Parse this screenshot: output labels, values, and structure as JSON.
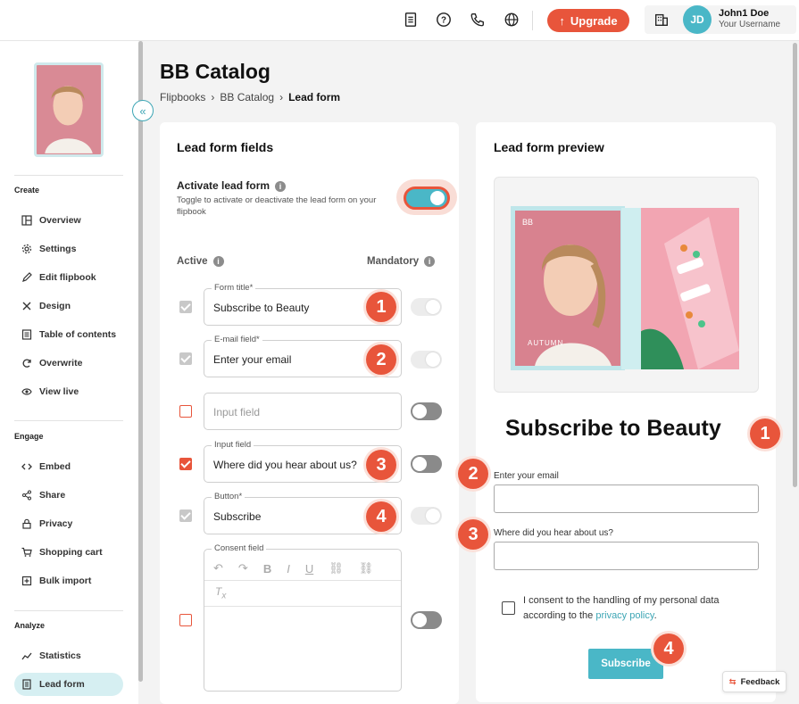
{
  "topbar": {
    "upgrade_label": "Upgrade",
    "user_initials": "JD",
    "user_name": "John1 Doe",
    "user_sub": "Your Username",
    "accent_color": "#e8553b"
  },
  "sidebar": {
    "sections": {
      "create": "Create",
      "engage": "Engage",
      "analyze": "Analyze"
    },
    "items": [
      {
        "label": "Overview",
        "icon": "overview-icon"
      },
      {
        "label": "Settings",
        "icon": "gear-icon"
      },
      {
        "label": "Edit flipbook",
        "icon": "pencil-icon"
      },
      {
        "label": "Design",
        "icon": "design-icon"
      },
      {
        "label": "Table of contents",
        "icon": "list-icon"
      },
      {
        "label": "Overwrite",
        "icon": "refresh-icon"
      },
      {
        "label": "View live",
        "icon": "eye-icon"
      },
      {
        "label": "Embed",
        "icon": "code-icon"
      },
      {
        "label": "Share",
        "icon": "share-icon"
      },
      {
        "label": "Privacy",
        "icon": "lock-icon"
      },
      {
        "label": "Shopping cart",
        "icon": "cart-icon"
      },
      {
        "label": "Bulk import",
        "icon": "import-icon"
      },
      {
        "label": "Statistics",
        "icon": "chart-icon"
      },
      {
        "label": "Lead form",
        "icon": "form-icon",
        "active": true
      }
    ]
  },
  "page": {
    "title": "BB Catalog",
    "breadcrumb": [
      "Flipbooks",
      "BB Catalog",
      "Lead form"
    ]
  },
  "fields_card": {
    "title": "Lead form fields",
    "activate_title": "Activate lead form",
    "activate_desc": "Toggle to activate or deactivate the lead form on your flipbook",
    "col_active": "Active",
    "col_mandatory": "Mandatory",
    "rows": [
      {
        "legend": "Form title*",
        "value": "Subscribe to Beauty",
        "badge": "1"
      },
      {
        "legend": "E-mail field*",
        "value": "Enter your email",
        "badge": "2"
      },
      {
        "legend": "",
        "placeholder": "Input field"
      },
      {
        "legend": "Input field",
        "value": "Where did you hear about us?",
        "badge": "3"
      },
      {
        "legend": "Button*",
        "value": "Subscribe",
        "badge": "4"
      }
    ],
    "consent_legend": "Consent field"
  },
  "preview_card": {
    "title": "Lead form preview",
    "cover_brand": "BB",
    "cover_text": "AUTUMN",
    "form_title": "Subscribe to Beauty",
    "email_label": "Enter your email",
    "question_label": "Where did you hear about us?",
    "consent_text": "I consent to the handling of my personal data according to the",
    "consent_link": "privacy policy",
    "consent_end": ".",
    "submit_label": "Subscribe",
    "badges": [
      "1",
      "2",
      "3",
      "4"
    ]
  },
  "feedback_label": "Feedback"
}
